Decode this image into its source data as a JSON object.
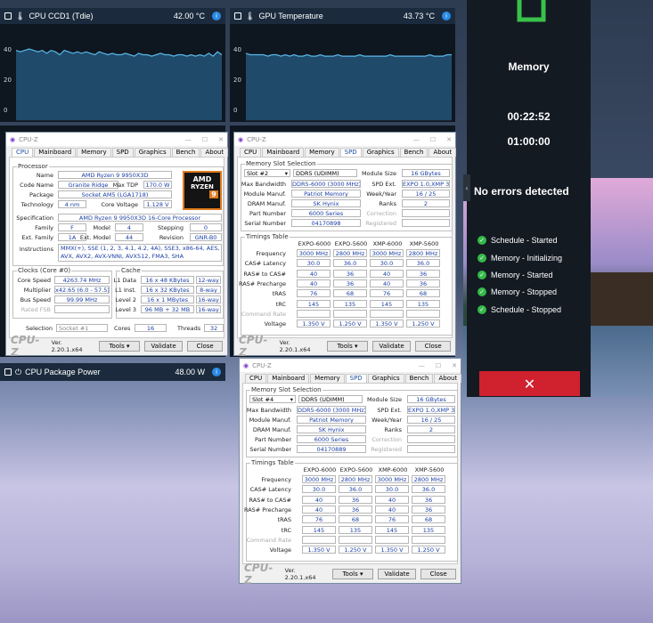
{
  "sensors": [
    {
      "title": "CPU CCD1 (Tdie)",
      "value": "42.00 °C",
      "ticks": [
        "40",
        "20",
        "0"
      ],
      "series": [
        48,
        47,
        48,
        49,
        48,
        47,
        48,
        46,
        48,
        47,
        45,
        48,
        47,
        46,
        47,
        46,
        47,
        46,
        45,
        47,
        46,
        45,
        46,
        45,
        45,
        46,
        45,
        44,
        46,
        45,
        45,
        44,
        45,
        46,
        45,
        45,
        44,
        45,
        45,
        44,
        45,
        44,
        45,
        44,
        46,
        44,
        47,
        45
      ]
    },
    {
      "title": "GPU Temperature",
      "value": "43.73 °C",
      "ticks": [
        "40",
        "20",
        "0"
      ],
      "series": [
        46,
        45,
        45,
        45,
        45,
        44,
        45,
        45,
        44,
        45,
        44,
        45,
        44,
        44,
        45,
        44,
        44,
        45,
        44,
        44,
        44,
        45,
        44,
        44,
        44,
        44,
        45,
        44,
        44,
        44,
        44,
        44,
        44,
        45,
        44,
        44,
        44,
        44,
        44,
        44,
        44,
        44,
        45,
        44,
        44,
        44,
        45,
        45
      ]
    },
    {
      "title": "CPU Package Power",
      "value": "48.00 W"
    }
  ],
  "sensor_info": "i",
  "side": {
    "title": "Memory",
    "time1": "00:22:52",
    "time2": "01:00:00",
    "status": "No errors detected",
    "collapse": "‹",
    "close": "✕",
    "check": "✓",
    "events": [
      "Schedule - Started",
      "Memory - Initializing",
      "Memory - Started",
      "Memory - Stopped",
      "Schedule - Stopped"
    ]
  },
  "cpuz_common": {
    "title": "CPU-Z",
    "tabs": [
      "CPU",
      "Mainboard",
      "Memory",
      "SPD",
      "Graphics",
      "Bench",
      "About"
    ],
    "logo": "CPU-Z",
    "version": "Ver. 2.20.1.x64",
    "tools": "Tools",
    "validate": "Validate",
    "close": "Close",
    "min": "—",
    "max": "☐",
    "x": "✕"
  },
  "cpu": {
    "processor": "Processor",
    "rows": [
      [
        "Name",
        "AMD Ryzen 9 9950X3D"
      ],
      [
        "Code Name",
        "Granite Ridge"
      ],
      [
        "Package",
        "Socket AM5 (LGA1718)"
      ],
      [
        "Specification",
        "AMD Ryzen 9 9950X3D 16-Core Processor"
      ],
      [
        "Instructions",
        "MMX(+), SSE (1, 2, 3, 4.1, 4.2, 4A), SSE3, x86-64, AES, AVX, AVX2, AVX-VNNI, AVX512, FMA3, SHA"
      ]
    ],
    "maxtdp_l": "Max TDP",
    "maxtdp": "170.0 W",
    "tech_l": "Technology",
    "tech": "4 nm",
    "cv_l": "Core Voltage",
    "cv": "1.128 V",
    "family_l": "Family",
    "family": "F",
    "model_l": "Model",
    "model": "4",
    "stepping_l": "Stepping",
    "stepping": "0",
    "extfam_l": "Ext. Family",
    "extfam": "1A",
    "extmod_l": "Ext. Model",
    "extmod": "44",
    "rev_l": "Revision",
    "rev": "GNR-B0",
    "clocks": "Clocks (Core #0)",
    "cache": "Cache",
    "cs_l": "Core Speed",
    "cs": "4263.74 MHz",
    "mult_l": "Multiplier",
    "mult": "x42.65 (6.0 - 57.5)",
    "bus_l": "Bus Speed",
    "bus": "99.99 MHz",
    "fsb_l": "Rated FSB",
    "l1d_l": "L1 Data",
    "l1d": "16 x 48 KBytes",
    "l1d_w": "12-way",
    "l1i_l": "L1 Inst.",
    "l1i": "16 x 32 KBytes",
    "l1i_w": "8-way",
    "l2_l": "Level 2",
    "l2": "16 x 1 MBytes",
    "l2_w": "16-way",
    "l3_l": "Level 3",
    "l3": "96 MB + 32 MB",
    "l3_w": "16-way",
    "sel_l": "Selection",
    "sel": "Socket #1",
    "cores_l": "Cores",
    "cores": "16",
    "threads_l": "Threads",
    "threads": "32",
    "amd": "AMD",
    "ryzen": "RYZEN",
    "nine": "9"
  },
  "spd_labels": {
    "slot_group": "Memory Slot Selection",
    "module_size": "Module Size",
    "max_bw": "Max Bandwidth",
    "spd_ext": "SPD Ext.",
    "manuf": "Module Manuf.",
    "week": "Week/Year",
    "dram": "DRAM Manuf.",
    "ranks": "Ranks",
    "part": "Part Number",
    "correction": "Correction",
    "serial": "Serial Number",
    "registered": "Registered",
    "timings": "Timings Table",
    "rows": [
      "Frequency",
      "CAS# Latency",
      "RAS# to CAS#",
      "RAS# Precharge",
      "tRAS",
      "tRC",
      "Command Rate",
      "Voltage"
    ]
  },
  "spd_values": {
    "type": "DDR5 (UDIMM)",
    "size": "16 GBytes",
    "bw": "DDR5-6000 (3000 MHz)",
    "ext": "EXPO 1.0,XMP 3.0",
    "manuf": "Patriot Memory",
    "week": "16 / 25",
    "dram": "SK Hynix",
    "ranks": "2",
    "part": "6000 Series",
    "cols": [
      "EXPO-6000",
      "EXPO-5600",
      "XMP-6000",
      "XMP-5600"
    ],
    "table": [
      [
        "3000 MHz",
        "2800 MHz",
        "3000 MHz",
        "2800 MHz"
      ],
      [
        "30.0",
        "36.0",
        "30.0",
        "36.0"
      ],
      [
        "40",
        "36",
        "40",
        "36"
      ],
      [
        "40",
        "36",
        "40",
        "36"
      ],
      [
        "76",
        "68",
        "76",
        "68"
      ],
      [
        "145",
        "135",
        "145",
        "135"
      ],
      [
        "",
        "",
        "",
        ""
      ],
      [
        "1.350 V",
        "1.250 V",
        "1.350 V",
        "1.250 V"
      ]
    ]
  },
  "spd1": {
    "slot": "Slot #2",
    "serial": "04170898"
  },
  "spd2": {
    "slot": "Slot #4",
    "serial": "04170889"
  }
}
